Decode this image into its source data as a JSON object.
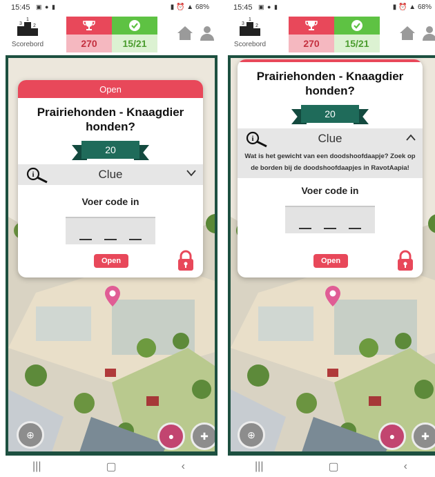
{
  "screens": [
    {
      "status": {
        "time": "15:45",
        "battery": "68%"
      },
      "scoreboard_label": "Scorebord",
      "score": "270",
      "progress": "15/21",
      "popup": {
        "header": "Open",
        "title": "Prairiehonden - Knaagdier honden?",
        "points": "20",
        "clue_label": "Clue",
        "clue_expanded": false,
        "clue_text": "",
        "code_label": "Voer code in",
        "open_button": "Open"
      }
    },
    {
      "status": {
        "time": "15:45",
        "battery": "68%"
      },
      "scoreboard_label": "Scorebord",
      "score": "270",
      "progress": "15/21",
      "popup": {
        "header": "",
        "title": "Prairiehonden - Knaagdier honden?",
        "points": "20",
        "clue_label": "Clue",
        "clue_expanded": true,
        "clue_text": "Wat is het gewicht van een doodshoofdaapje? Zoek op de borden bij de doodshoofdaapjes in RavotAapia!",
        "code_label": "Voer code in",
        "open_button": "Open"
      }
    }
  ],
  "icons": {
    "scoreboard": "podium-icon",
    "score": "trophy-icon",
    "progress": "checkmark-icon",
    "home": "home-icon",
    "user": "user-icon",
    "clue": "magnifier-icon",
    "lock": "lock-icon",
    "map_pin": "map-pin-icon"
  },
  "colors": {
    "accent_red": "#e8485a",
    "accent_green": "#5ec243",
    "frame_green": "#1d5040",
    "ribbon_green": "#1f6b5a"
  }
}
